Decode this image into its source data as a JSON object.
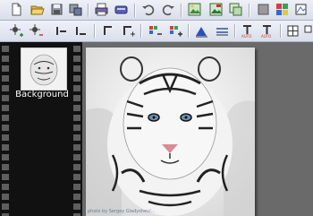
{
  "layers": [
    {
      "name": "Background",
      "selected": true
    }
  ],
  "image_credit": "photo by Sergey Gladyshev/...",
  "icons": {
    "row1": [
      "new-file-icon",
      "open-folder-icon",
      "save-icon",
      "save-as-icon",
      "print-icon",
      "scan-icon",
      "undo-icon",
      "redo-icon",
      "image-import-icon",
      "image-export-icon",
      "copy-image-icon",
      "gray-square-icon",
      "color-swatch-icon",
      "crop-icon"
    ],
    "row2": [
      "select-add-icon",
      "select-subtract-icon",
      "shrink-left-icon",
      "shrink-right-icon",
      "line-up-icon",
      "line-plus-icon",
      "color-shift-icon",
      "color-plus-icon",
      "levels-icon",
      "threshold-icon",
      "text-auto-icon",
      "text-auto-minus-icon",
      "grid-icon",
      "add-layer-icon"
    ]
  },
  "colors": {
    "toolbar_bg": "#dde2ee",
    "filmstrip": "#111111",
    "workspace": "#6a6a6a"
  }
}
